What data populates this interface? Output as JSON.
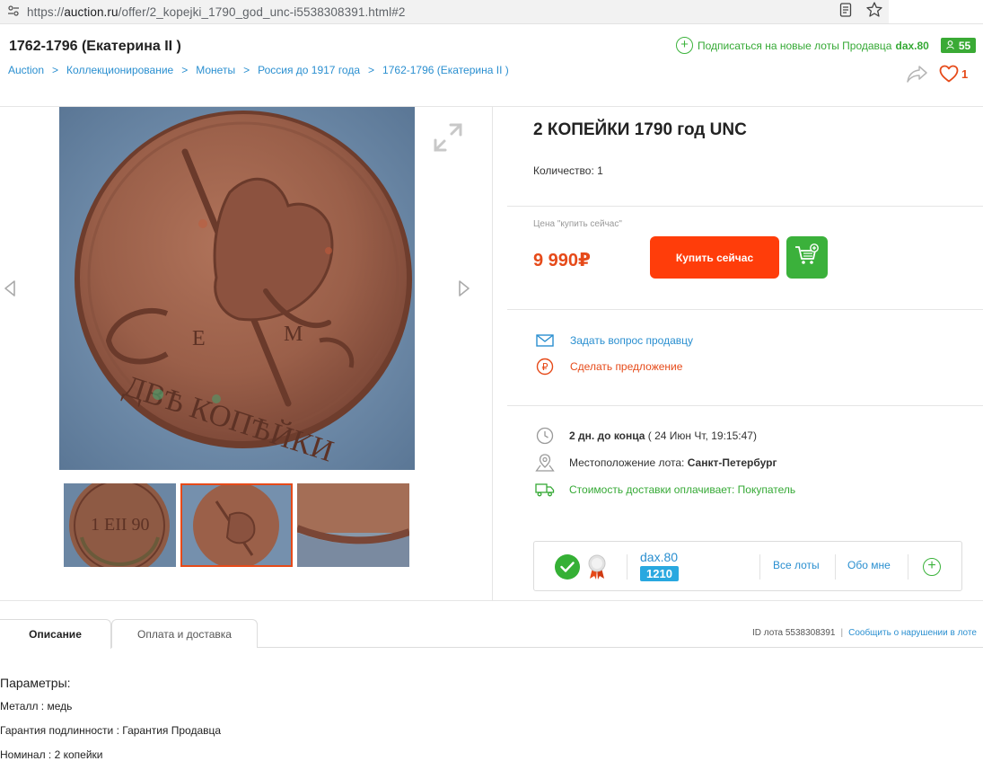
{
  "browser": {
    "url_scheme": "https://",
    "url_host": "auction.ru",
    "url_path": "/offer/2_kopejki_1790_god_unc-i5538308391.html#2"
  },
  "header": {
    "title": "1762-1796 (Екатерина II )",
    "breadcrumbs": [
      "Auction",
      "Коллекционирование",
      "Монеты",
      "Россия до 1917 года",
      "1762-1796 (Екатерина II )"
    ],
    "breadcrumb_sep": ">",
    "subscribe_text": "Подписаться на новые лоты Продавца",
    "subscribe_seller": "dax.80",
    "rating": "55",
    "favorites_count": "1"
  },
  "lot": {
    "title": "2 КОПЕЙКИ 1790 год UNC",
    "quantity": "Количество: 1",
    "price_label": "Цена \"купить сейчас\"",
    "price": "9 990₽",
    "buy_label": "Купить сейчас",
    "ask_seller": "Задать вопрос продавцу",
    "make_offer": "Сделать предложение",
    "time_left": "2 дн. до конца",
    "end_date": "( 24 Июн Чт, 19:15:47)",
    "location_label": "Местоположение лота:",
    "location_value": "Санкт-Петербург",
    "shipping": "Стоимость доставки оплачивает: Покупатель"
  },
  "seller": {
    "name": "dax.80",
    "count": "1210",
    "all_lots": "Все лоты",
    "about": "Обо мне"
  },
  "tabs": {
    "description": "Описание",
    "payment": "Оплата и доставка",
    "lot_id": "ID лота 5538308391",
    "id_sep": "|",
    "report": "Сообщить о нарушении в лоте"
  },
  "params": {
    "title": "Параметры:",
    "items": [
      "Металл : медь",
      "Гарантия подлинности : Гарантия Продавца",
      "Номинал : 2 копейки"
    ]
  },
  "colors": {
    "accent_orange": "#ff3d0a",
    "price_red": "#e64a19",
    "link_blue": "#2a8fd0",
    "green": "#3bb13b"
  }
}
